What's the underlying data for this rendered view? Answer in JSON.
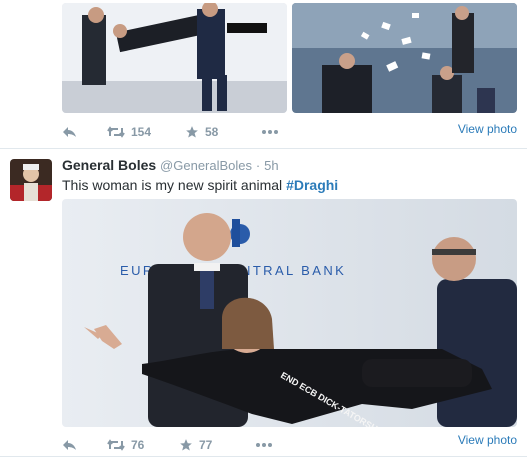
{
  "previous_tweet": {
    "actions": {
      "retweet_count": "154",
      "favorite_count": "58"
    },
    "view_photo": "View photo"
  },
  "tweet": {
    "author_name": "General Boles",
    "handle": "@GeneralBoles",
    "separator": "·",
    "time": "5h",
    "text": "This woman is my new spirit animal",
    "hashtag": "#Draghi",
    "photo_sign_text": "EUROPEAN CENTRAL BANK",
    "photo_shirt_text": "END ECB DICK-TATORSHIP",
    "actions": {
      "retweet_count": "76",
      "favorite_count": "77"
    },
    "view_photo": "View photo"
  },
  "colors": {
    "link": "#2b7bb9",
    "muted": "#8899a6",
    "text": "#292f33",
    "divider": "#e1e8ed"
  }
}
